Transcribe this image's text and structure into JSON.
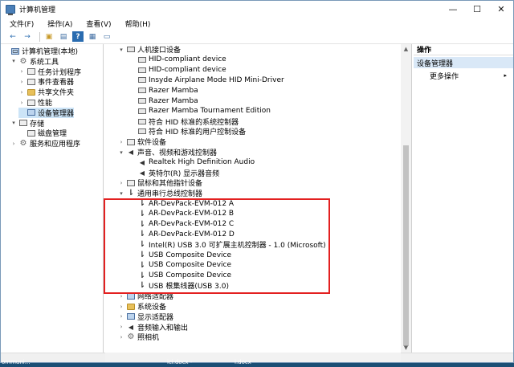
{
  "window": {
    "title": "计算机管理",
    "minimize": "—",
    "maximize": "☐",
    "close": "✕"
  },
  "menu": [
    "文件(F)",
    "操作(A)",
    "查看(V)",
    "帮助(H)"
  ],
  "toolbar": [
    {
      "icon": "back-arrow-icon",
      "glyph": "←"
    },
    {
      "icon": "forward-arrow-icon",
      "glyph": "→"
    },
    {
      "icon": "folder-up-icon",
      "glyph": "▣"
    },
    {
      "icon": "console-tree-icon",
      "glyph": "▤"
    },
    {
      "icon": "help-icon",
      "glyph": "?"
    },
    {
      "icon": "properties-icon",
      "glyph": "▦"
    },
    {
      "icon": "monitor-icon",
      "glyph": "▭"
    }
  ],
  "left_tree": [
    {
      "label": "计算机管理(本地)",
      "indent": 0,
      "toggle": "",
      "icon": "computer"
    },
    {
      "label": "系统工具",
      "indent": 1,
      "toggle": "▾",
      "icon": "gear"
    },
    {
      "label": "任务计划程序",
      "indent": 2,
      "toggle": "›",
      "icon": "box"
    },
    {
      "label": "事件查看器",
      "indent": 2,
      "toggle": "›",
      "icon": "box"
    },
    {
      "label": "共享文件夹",
      "indent": 2,
      "toggle": "›",
      "icon": "folder"
    },
    {
      "label": "性能",
      "indent": 2,
      "toggle": "›",
      "icon": "box"
    },
    {
      "label": "设备管理器",
      "indent": 2,
      "toggle": "",
      "icon": "monitor",
      "selected": true
    },
    {
      "label": "存储",
      "indent": 1,
      "toggle": "▾",
      "icon": "box"
    },
    {
      "label": "磁盘管理",
      "indent": 2,
      "toggle": "",
      "icon": "box"
    },
    {
      "label": "服务和应用程序",
      "indent": 1,
      "toggle": "›",
      "icon": "gear"
    }
  ],
  "device_tree": [
    {
      "label": "人机接口设备",
      "indent": 1,
      "toggle": "▾",
      "icon": "hid"
    },
    {
      "label": "HID-compliant device",
      "indent": 2,
      "toggle": "",
      "icon": "hid"
    },
    {
      "label": "HID-compliant device",
      "indent": 2,
      "toggle": "",
      "icon": "hid"
    },
    {
      "label": "Insyde Airplane Mode HID Mini-Driver",
      "indent": 2,
      "toggle": "",
      "icon": "hid"
    },
    {
      "label": "Razer Mamba",
      "indent": 2,
      "toggle": "",
      "icon": "hid"
    },
    {
      "label": "Razer Mamba",
      "indent": 2,
      "toggle": "",
      "icon": "hid"
    },
    {
      "label": "Razer Mamba Tournament Edition",
      "indent": 2,
      "toggle": "",
      "icon": "hid"
    },
    {
      "label": "符合 HID 标准的系统控制器",
      "indent": 2,
      "toggle": "",
      "icon": "hid"
    },
    {
      "label": "符合 HID 标准的用户控制设备",
      "indent": 2,
      "toggle": "",
      "icon": "hid"
    },
    {
      "label": "软件设备",
      "indent": 1,
      "toggle": "›",
      "icon": "box"
    },
    {
      "label": "声音、视频和游戏控制器",
      "indent": 1,
      "toggle": "▾",
      "icon": "spk"
    },
    {
      "label": "Realtek High Definition Audio",
      "indent": 2,
      "toggle": "",
      "icon": "spk"
    },
    {
      "label": "英特尔(R) 显示器音频",
      "indent": 2,
      "toggle": "",
      "icon": "spk"
    },
    {
      "label": "鼠标和其他指针设备",
      "indent": 1,
      "toggle": "›",
      "icon": "box"
    },
    {
      "label": "通用串行总线控制器",
      "indent": 1,
      "toggle": "▾",
      "icon": "usb"
    },
    {
      "label": "AR-DevPack-EVM-012 A",
      "indent": 2,
      "toggle": "",
      "icon": "usb"
    },
    {
      "label": "AR-DevPack-EVM-012 B",
      "indent": 2,
      "toggle": "",
      "icon": "usb"
    },
    {
      "label": "AR-DevPack-EVM-012 C",
      "indent": 2,
      "toggle": "",
      "icon": "usb"
    },
    {
      "label": "AR-DevPack-EVM-012 D",
      "indent": 2,
      "toggle": "",
      "icon": "usb"
    },
    {
      "label": "Intel(R) USB 3.0 可扩展主机控制器 - 1.0 (Microsoft)",
      "indent": 2,
      "toggle": "",
      "icon": "usb"
    },
    {
      "label": "USB Composite Device",
      "indent": 2,
      "toggle": "",
      "icon": "usb"
    },
    {
      "label": "USB Composite Device",
      "indent": 2,
      "toggle": "",
      "icon": "usb"
    },
    {
      "label": "USB Composite Device",
      "indent": 2,
      "toggle": "",
      "icon": "usb"
    },
    {
      "label": "USB 根集线器(USB 3.0)",
      "indent": 2,
      "toggle": "",
      "icon": "usb"
    },
    {
      "label": "网络适配器",
      "indent": 1,
      "toggle": "›",
      "icon": "monitor"
    },
    {
      "label": "系统设备",
      "indent": 1,
      "toggle": "›",
      "icon": "folder"
    },
    {
      "label": "显示适配器",
      "indent": 1,
      "toggle": "›",
      "icon": "monitor"
    },
    {
      "label": "音频输入和输出",
      "indent": 1,
      "toggle": "›",
      "icon": "spk"
    },
    {
      "label": "照相机",
      "indent": 1,
      "toggle": "›",
      "icon": "gear"
    }
  ],
  "actions": {
    "header": "操作",
    "selected": "设备管理器",
    "more": "更多操作",
    "more_arrow": "▸"
  },
  "taskbar": {
    "item1": "ommuni...",
    "item2": "ici.docx -",
    "item3": "i.docx"
  }
}
